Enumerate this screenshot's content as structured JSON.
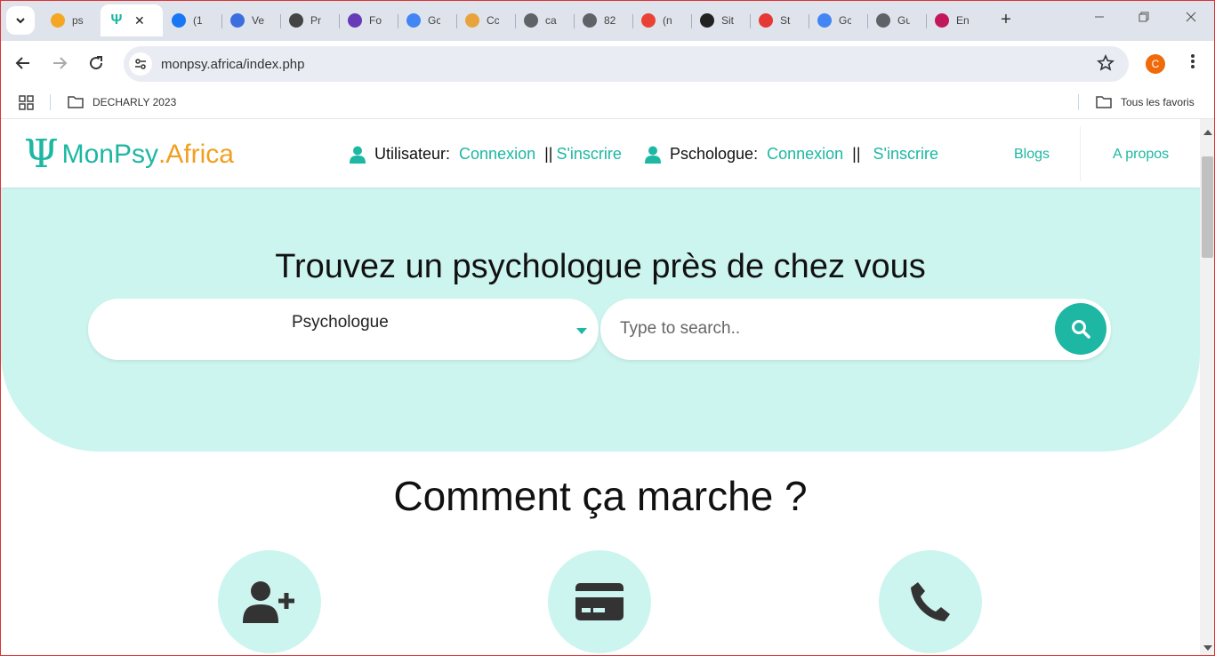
{
  "browser": {
    "tabs": [
      {
        "label": "ps",
        "icon": "orange-circle-icon",
        "color": "#f5a623"
      },
      {
        "label": "",
        "icon": "psi-icon",
        "color": "#1db7a3",
        "active": true
      },
      {
        "label": "(1",
        "icon": "facebook-icon",
        "color": "#1877f2"
      },
      {
        "label": "Ve",
        "icon": "form-icon",
        "color": "#3b6fe0"
      },
      {
        "label": "Pr",
        "icon": "openai-icon",
        "color": "#444444"
      },
      {
        "label": "Fo",
        "icon": "forms-icon",
        "color": "#673ab7"
      },
      {
        "label": "Gc",
        "icon": "docs-icon",
        "color": "#4285f4"
      },
      {
        "label": "Cc",
        "icon": "shield-icon",
        "color": "#e8a33d"
      },
      {
        "label": "ca",
        "icon": "globe-icon",
        "color": "#5f6368"
      },
      {
        "label": "82",
        "icon": "globe-icon",
        "color": "#5f6368"
      },
      {
        "label": "(n",
        "icon": "gmail-icon",
        "color": "#ea4335"
      },
      {
        "label": "Sit",
        "icon": "codepen-icon",
        "color": "#222222"
      },
      {
        "label": "St",
        "icon": "hsu-icon",
        "color": "#e53935"
      },
      {
        "label": "Gc",
        "icon": "translate-icon",
        "color": "#4285f4"
      },
      {
        "label": "Gu",
        "icon": "globe-icon",
        "color": "#5f6368"
      },
      {
        "label": "En",
        "icon": "flag-icon",
        "color": "#c2185b"
      }
    ],
    "close_glyph": "✕",
    "new_tab_glyph": "+",
    "url": "monpsy.africa/index.php",
    "profile_initial": "C",
    "bookmarks": {
      "folder": "DECHARLY 2023",
      "all_bookmarks": "Tous les favoris"
    }
  },
  "site": {
    "logo": {
      "symbol": "Ψ",
      "part1": "MonPsy",
      "part2": ".Africa"
    },
    "user_auth": {
      "label": "Utilisateur:",
      "login": "Connexion",
      "separator": "||",
      "signup": "S'inscrire"
    },
    "psy_auth": {
      "label": "Pschologue:",
      "login": "Connexion",
      "separator": "||",
      "signup": "S'inscrire"
    },
    "nav": {
      "blogs": "Blogs",
      "about": "A propos"
    },
    "hero": {
      "title": "Trouvez un psychologue près de chez vous",
      "select_value": "Psychologue",
      "search_placeholder": "Type to search.."
    },
    "how_it_works": {
      "title": "Comment ça marche ?",
      "steps": [
        {
          "icon": "user-plus-icon"
        },
        {
          "icon": "credit-card-icon"
        },
        {
          "icon": "phone-icon"
        }
      ]
    },
    "colors": {
      "brand": "#1db7a3",
      "accent": "#f0a020",
      "hero_bg": "#cdf5f0"
    }
  }
}
